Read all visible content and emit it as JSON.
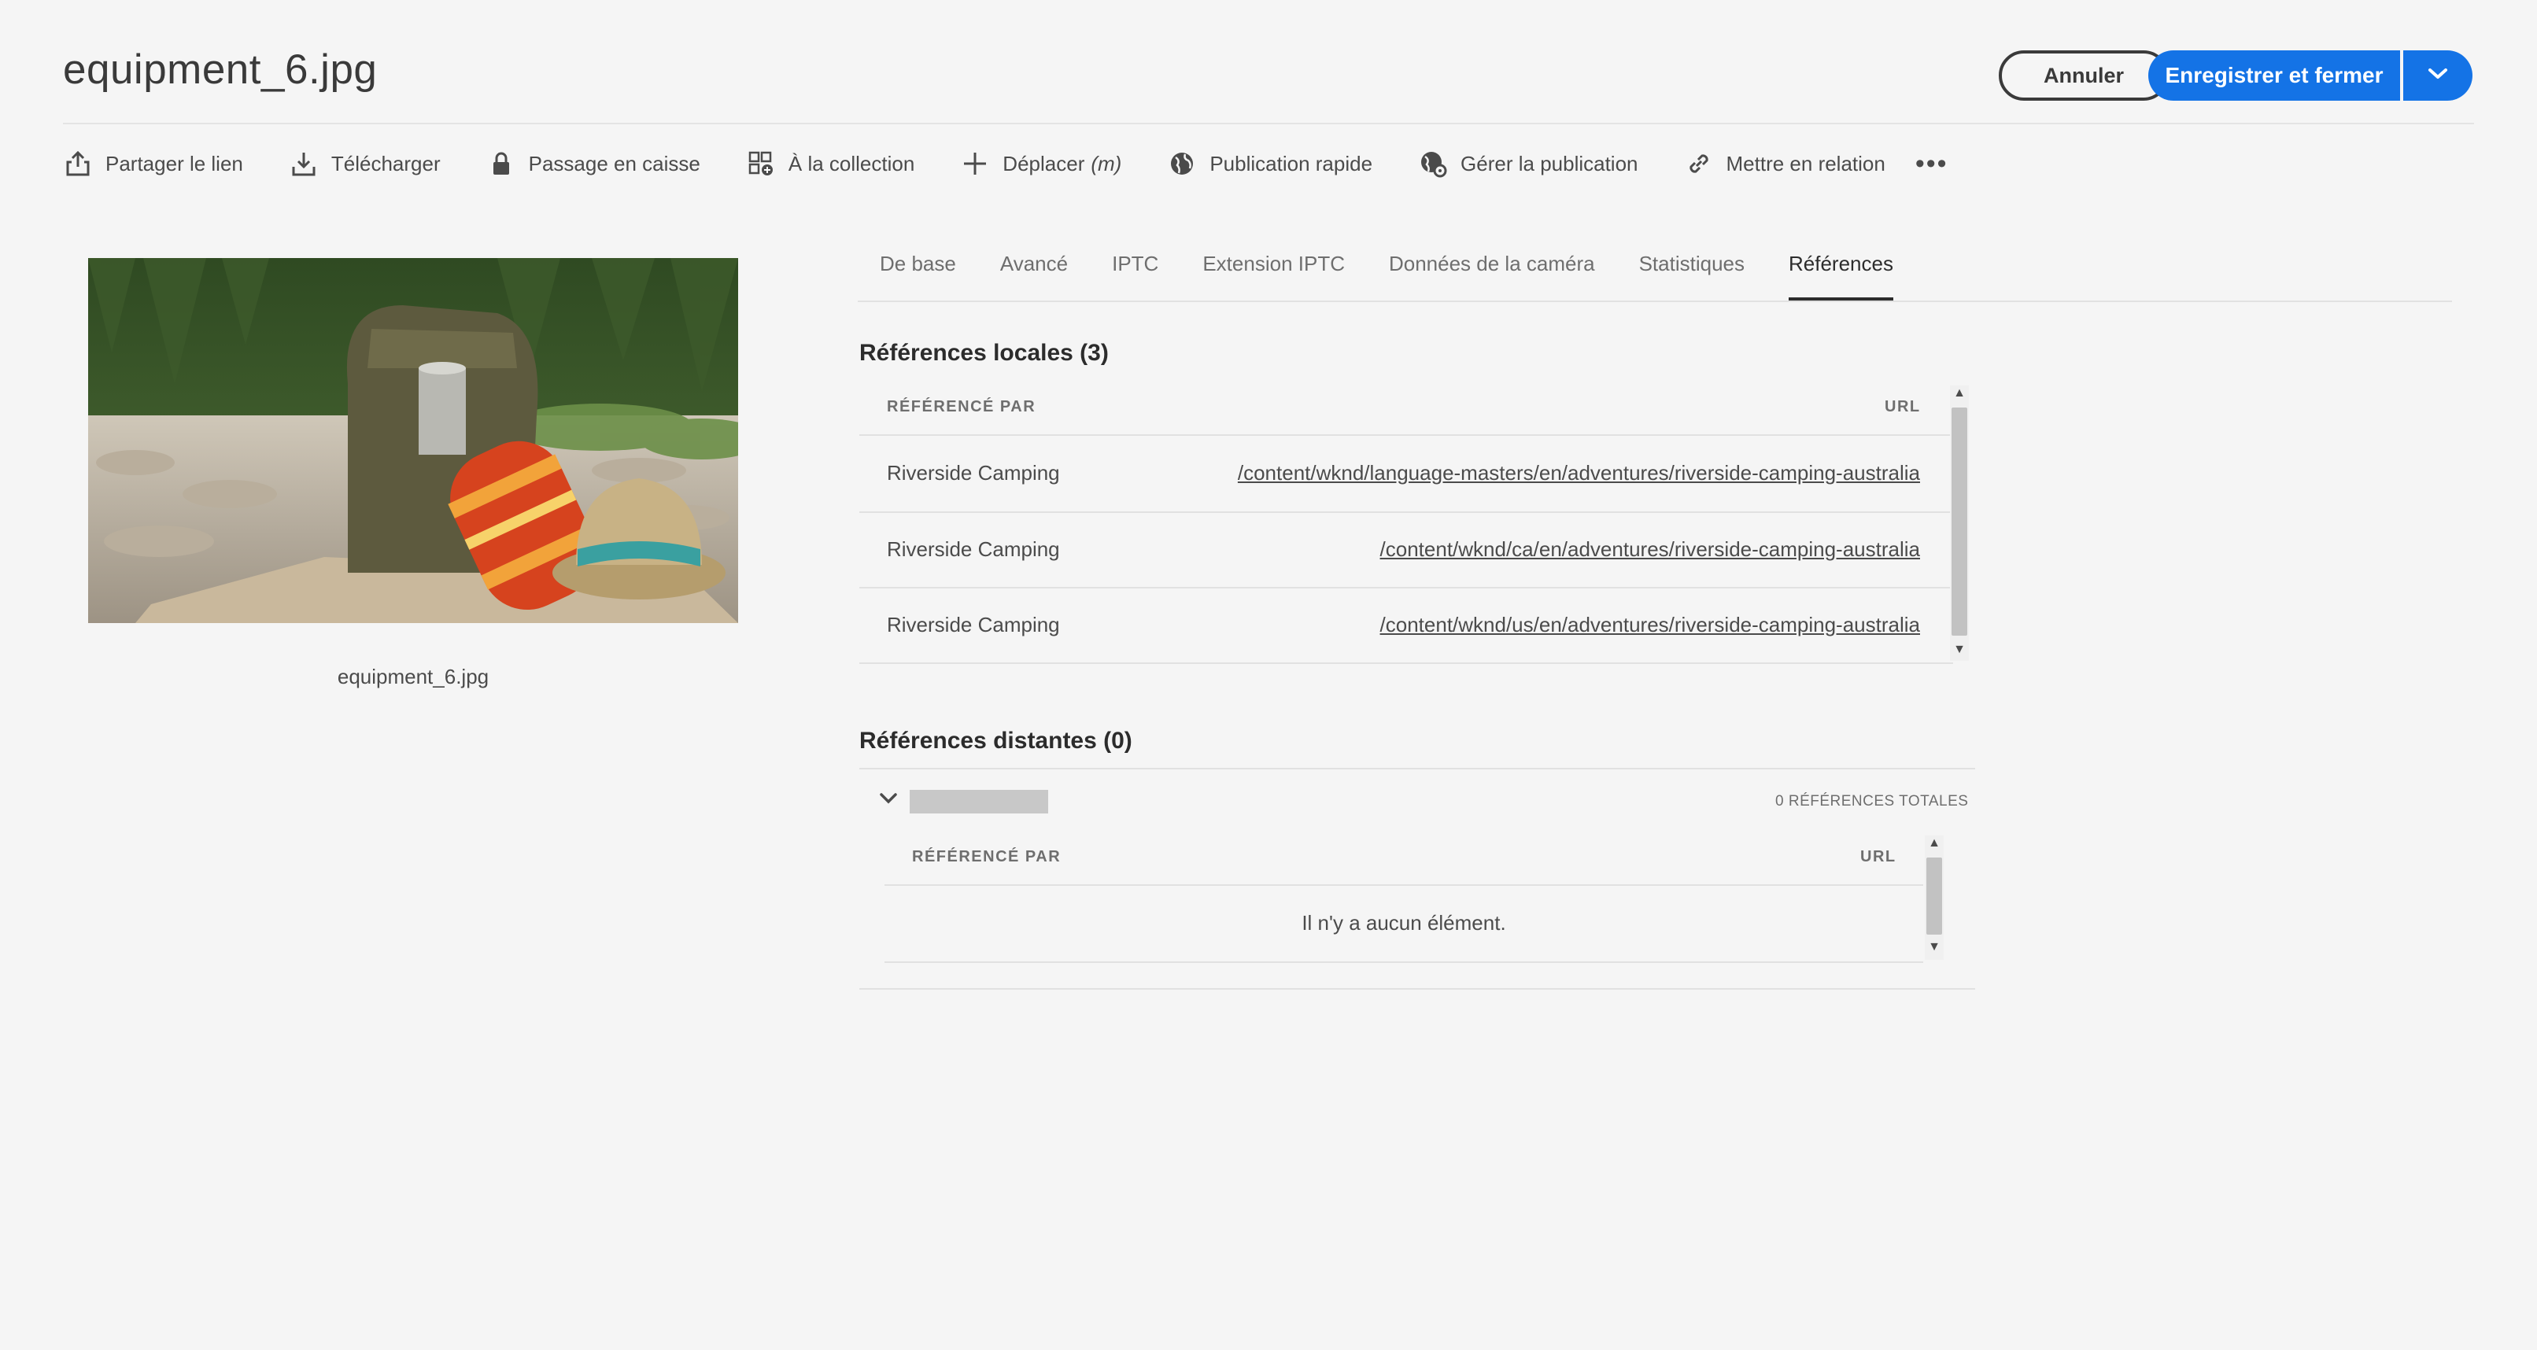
{
  "header": {
    "title": "equipment_6.jpg",
    "cancel_label": "Annuler",
    "save_label": "Enregistrer et fermer"
  },
  "actions": [
    {
      "label": "Partager le lien",
      "icon": "share-icon"
    },
    {
      "label": "Télécharger",
      "icon": "download-icon"
    },
    {
      "label": "Passage en caisse",
      "icon": "lock-icon"
    },
    {
      "label": "À la collection",
      "icon": "add-to-collection-icon"
    },
    {
      "label": "Déplacer",
      "shortcut": "(m)",
      "icon": "move-icon"
    },
    {
      "label": "Publication rapide",
      "icon": "globe-icon"
    },
    {
      "label": "Gérer la publication",
      "icon": "globe-gear-icon"
    },
    {
      "label": "Mettre en relation",
      "icon": "link-icon"
    }
  ],
  "preview": {
    "caption": "equipment_6.jpg"
  },
  "tabs": [
    {
      "label": "De base",
      "active": false
    },
    {
      "label": "Avancé",
      "active": false
    },
    {
      "label": "IPTC",
      "active": false
    },
    {
      "label": "Extension IPTC",
      "active": false
    },
    {
      "label": "Données de la caméra",
      "active": false
    },
    {
      "label": "Statistiques",
      "active": false
    },
    {
      "label": "Références",
      "active": true
    }
  ],
  "local_refs": {
    "title": "Références locales (3)",
    "col_referenced_by": "RÉFÉRENCÉ PAR",
    "col_url": "URL",
    "rows": [
      {
        "name": "Riverside Camping",
        "url": "/content/wknd/language-masters/en/adventures/riverside-camping-australia"
      },
      {
        "name": "Riverside Camping",
        "url": "/content/wknd/ca/en/adventures/riverside-camping-australia"
      },
      {
        "name": "Riverside Camping",
        "url": "/content/wknd/us/en/adventures/riverside-camping-australia"
      }
    ]
  },
  "remote_refs": {
    "title": "Références distantes (0)",
    "total_label": "0 RÉFÉRENCES TOTALES",
    "col_referenced_by": "RÉFÉRENCÉ PAR",
    "col_url": "URL",
    "empty_message": "Il n'y a aucun élément."
  },
  "colors": {
    "accent": "#1473e6",
    "background": "#f5f5f5"
  }
}
